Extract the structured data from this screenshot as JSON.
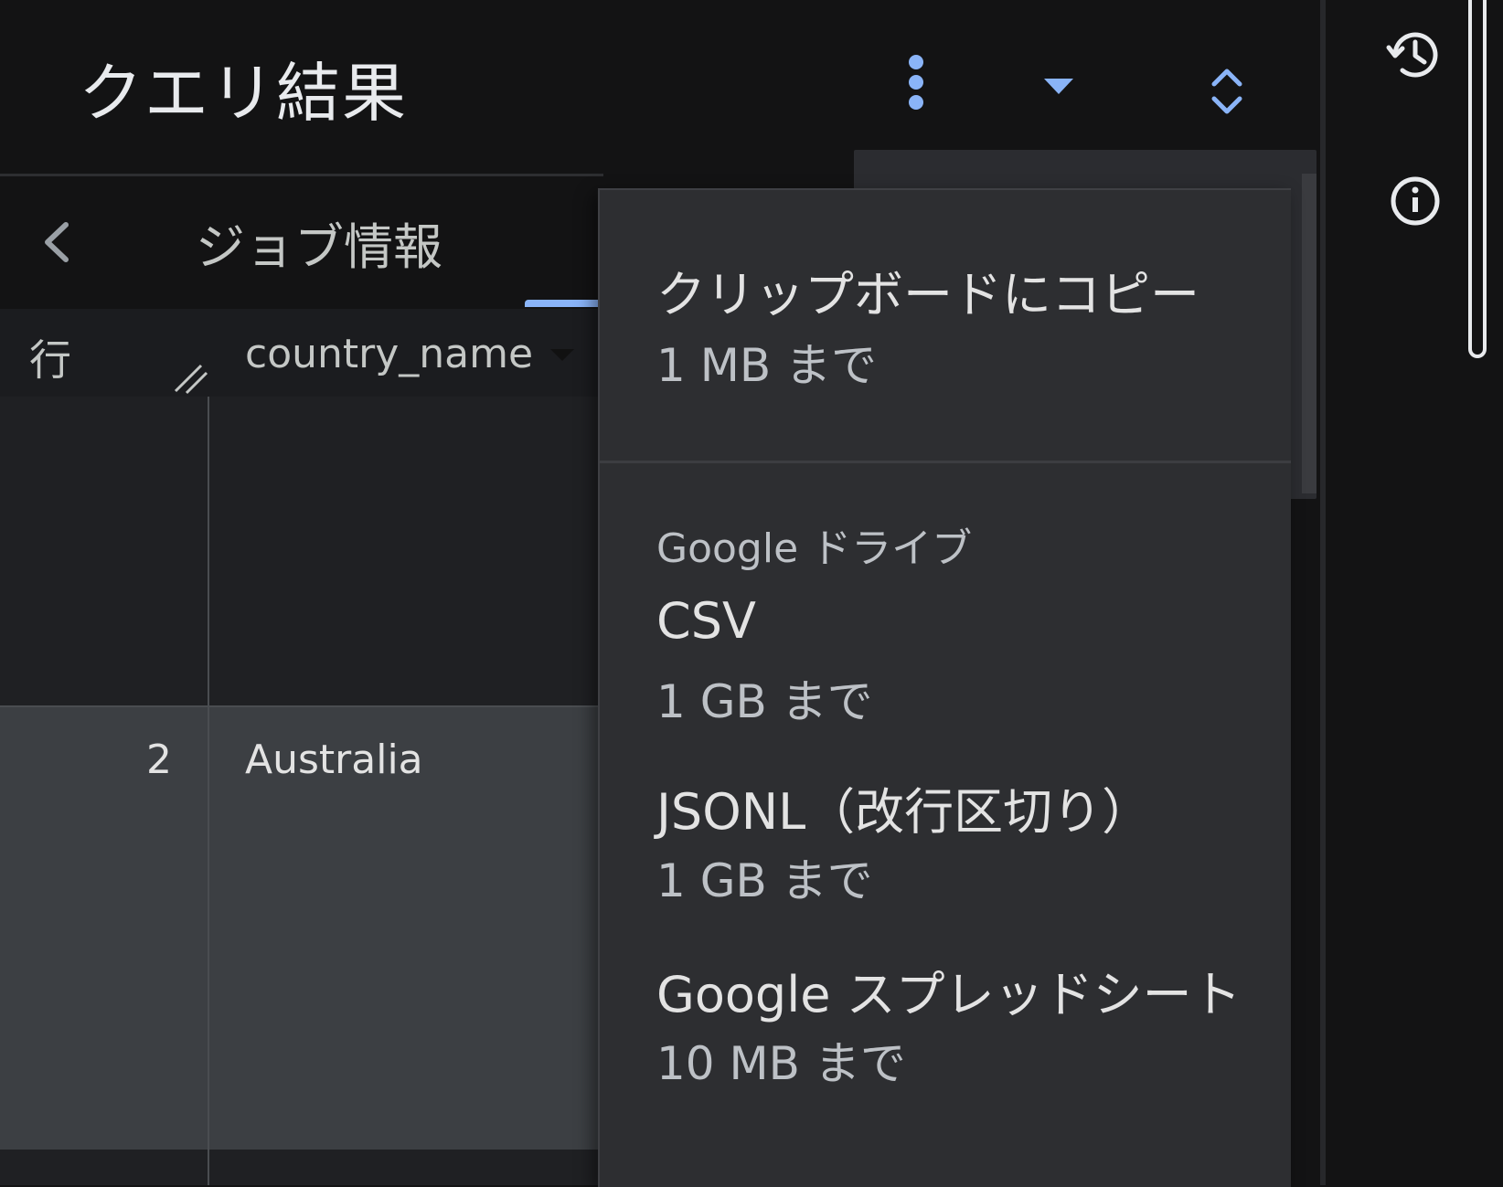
{
  "header": {
    "title": "クエリ結果"
  },
  "tabs": {
    "job_info": "ジョブ情報"
  },
  "table": {
    "columns": [
      "行",
      "country_name"
    ],
    "rows": [
      {
        "num": "",
        "country": ""
      },
      {
        "num": "2",
        "country": "Australia"
      }
    ]
  },
  "menu": {
    "clipboard": {
      "label": "クリップボードにコピー",
      "limit": "1 MB まで"
    },
    "drive_section": "Google ドライブ",
    "items": [
      {
        "label": "CSV",
        "limit": "1 GB まで"
      },
      {
        "label": "JSONL（改行区切り）",
        "limit": "1 GB まで"
      },
      {
        "label": "Google スプレッドシート",
        "limit": "10 MB まで"
      }
    ]
  },
  "icons": {
    "more": "more-vert-icon",
    "dropdown": "arrow-drop-down-icon",
    "expand": "unfold-more-icon",
    "history": "history-icon",
    "info": "info-icon",
    "prev": "chevron-left-icon"
  },
  "colors": {
    "accent": "#8ab4f8",
    "background": "#131314",
    "menu_bg": "#2d2e31",
    "selected_row": "#3c3f43"
  }
}
